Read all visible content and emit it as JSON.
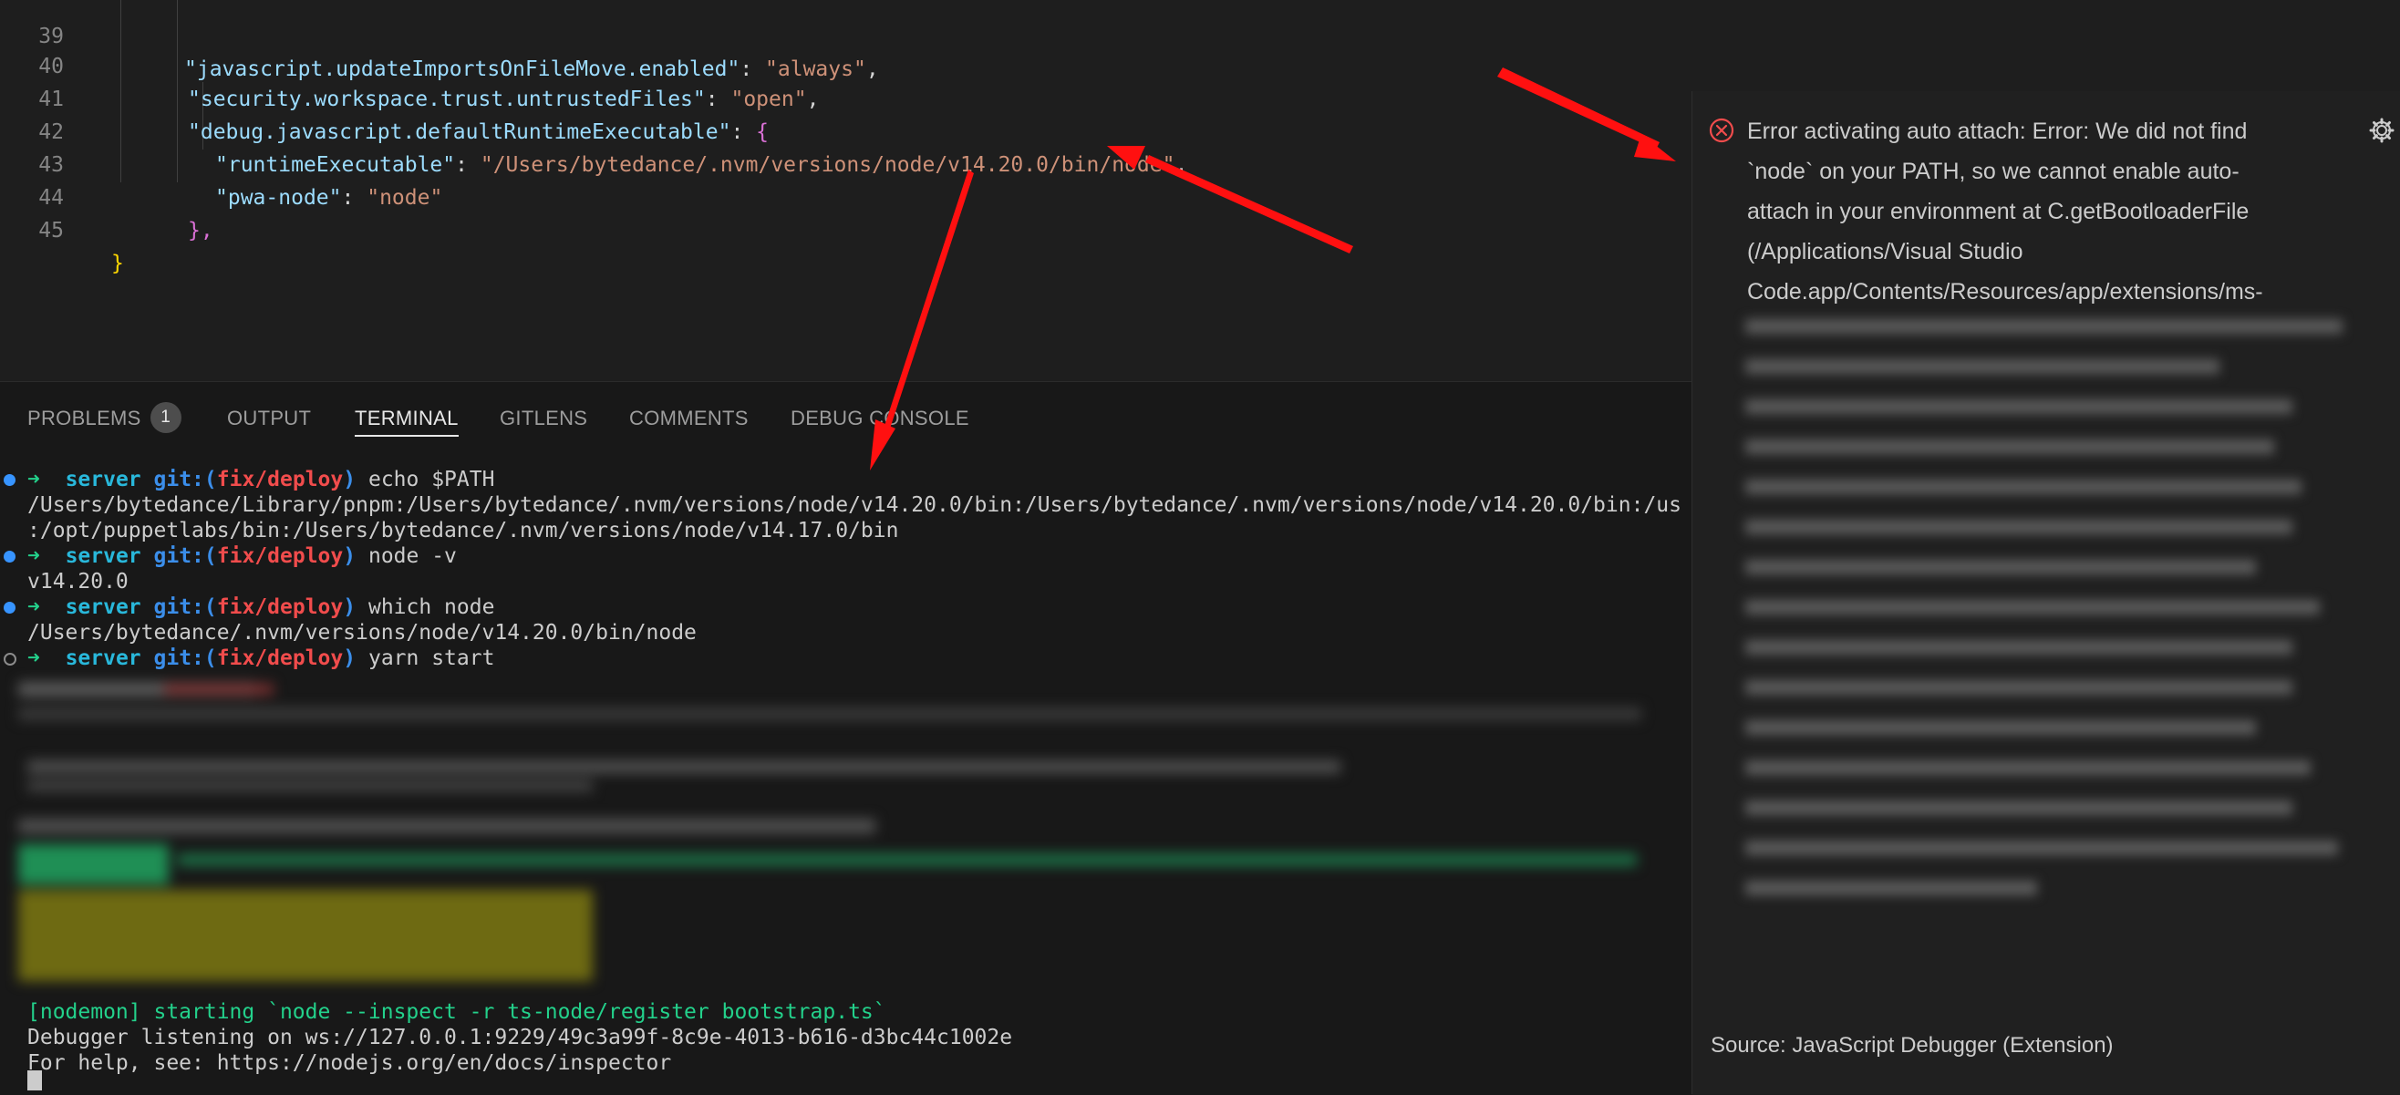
{
  "editor": {
    "lines": [
      {
        "num": "39",
        "key": "javascript.updateImportsOnFileMove.enabled",
        "value": "always"
      },
      {
        "num": "40",
        "key": "security.workspace.trust.untrustedFiles",
        "value": "open"
      },
      {
        "num": "41",
        "key": "debug.javascript.defaultRuntimeExecutable",
        "value": "{"
      },
      {
        "num": "42",
        "key": "runtimeExecutable",
        "value": "/Users/bytedance/.nvm/versions/node/v14.20.0/bin/node"
      },
      {
        "num": "43",
        "key": "pwa-node",
        "value": "node"
      },
      {
        "num": "44",
        "text": "},"
      },
      {
        "num": "45",
        "text": "}"
      }
    ]
  },
  "panel": {
    "tabs": [
      {
        "label": "PROBLEMS",
        "badge": "1"
      },
      {
        "label": "OUTPUT"
      },
      {
        "label": "TERMINAL",
        "active": true
      },
      {
        "label": "GITLENS"
      },
      {
        "label": "COMMENTS"
      },
      {
        "label": "DEBUG CONSOLE"
      }
    ]
  },
  "terminal": {
    "prompt": {
      "arrow": "➜",
      "dir": "server",
      "git": "git:",
      "open": "(",
      "branch": "fix/deploy",
      "close": ")"
    },
    "cmd1": "echo $PATH",
    "out1a": "/Users/bytedance/Library/pnpm:/Users/bytedance/.nvm/versions/node/v14.20.0/bin:/Users/bytedance/.nvm/versions/node/v14.20.0/bin:/us",
    "out1b": ":/opt/puppetlabs/bin:/Users/bytedance/.nvm/versions/node/v14.17.0/bin",
    "cmd2": "node -v",
    "out2": "v14.20.0",
    "cmd3": "which node",
    "out3": "/Users/bytedance/.nvm/versions/node/v14.20.0/bin/node",
    "cmd4": "yarn start",
    "nodemon": "[nodemon] starting `node --inspect -r ts-node/register bootstrap.ts`",
    "debugger": "Debugger listening on ws://127.0.0.1:9229/49c3a99f-8c9e-4013-b616-d3bc44c1002e",
    "help": "For help, see: https://nodejs.org/en/docs/inspector"
  },
  "notification": {
    "lines": [
      "Error activating auto attach: Error: We did not find",
      "`node` on your PATH, so we cannot enable auto-",
      "attach in your environment at C.getBootloaderFile",
      "(/Applications/Visual Studio",
      "Code.app/Contents/Resources/app/extensions/ms-"
    ],
    "source": "Source: JavaScript Debugger (Extension)"
  },
  "colors": {
    "accent_red": "#ff0000",
    "error_red": "#f14c4c",
    "terminal_green": "#23d18b",
    "link_blue": "#3794ff"
  },
  "icons": [
    "error-circle-icon",
    "gear-icon",
    "terminal-status-dot-icon"
  ]
}
